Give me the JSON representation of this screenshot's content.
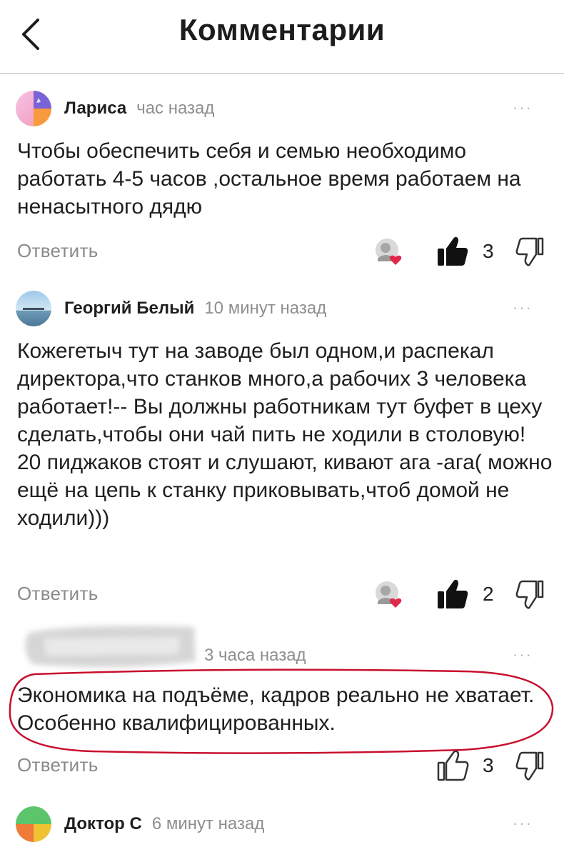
{
  "header": {
    "title": "Комментарии",
    "back_icon": "chevron-left-icon"
  },
  "comments": [
    {
      "author": "Лариса",
      "time": "час назад",
      "more": "···",
      "text": "Чтобы обеспечить себя и семью необходимо работать 4-5 часов ,остальное время работаем на ненасытного дядю",
      "reply": "Ответить",
      "likes": "3",
      "liked": true
    },
    {
      "author": "Георгий Белый",
      "time": "10 минут назад",
      "more": "···",
      "text": "Кожегетыч тут на заводе был одном,и распекал директора,что станков много,а рабочих 3 человека работает!-- Вы должны работникам тут буфет в цеху сделать,чтобы они чай пить не ходили в столовую! 20 пиджаков стоят и слушают, кивают ага -ага( можно ещё на цепь к станку приковывать,чтоб домой не ходили)))",
      "reply": "Ответить",
      "likes": "2",
      "liked": true
    },
    {
      "author": "",
      "time": "3 часа назад",
      "more": "···",
      "text": "Экономика на подъёме, кадров реально не хватает. Особенно квалифицированных.",
      "reply": "Ответить",
      "likes": "3",
      "liked": false
    },
    {
      "author": "Доктор С",
      "time": "6 минут назад",
      "more": "···"
    }
  ],
  "colors": {
    "accent_red": "#c8102e",
    "muted": "#8e8e8e",
    "text": "#1f1f1f"
  }
}
